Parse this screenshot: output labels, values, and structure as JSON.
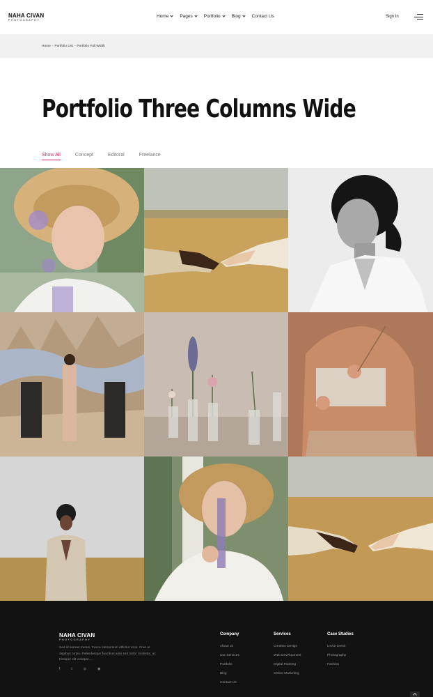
{
  "header": {
    "logo_name": "NAHA CIVAN",
    "logo_sub": "PHOTOGRAPHY",
    "nav": [
      {
        "label": "Home",
        "dropdown": true
      },
      {
        "label": "Pages",
        "dropdown": true
      },
      {
        "label": "Portfolio",
        "dropdown": true
      },
      {
        "label": "Blog",
        "dropdown": true
      },
      {
        "label": "Contact Us",
        "dropdown": false
      }
    ],
    "signin": "Sign In",
    "menu_icon": "hamburger-icon"
  },
  "breadcrumb": [
    "Home",
    "Portfolio List",
    "Portfolio Full Width"
  ],
  "page_title": "Portfolio Three Columns Wide",
  "filters": [
    {
      "label": "Show All",
      "active": true
    },
    {
      "label": "Concept",
      "active": false
    },
    {
      "label": "Editoral",
      "active": false
    },
    {
      "label": "Freelance",
      "active": false
    }
  ],
  "accent_color": "#d9255e",
  "grid": [
    "woman-straw-hat-flowers",
    "hands-reaching-wheat-field",
    "woman-profile-bw",
    "group-desert-fabric",
    "flowers-in-glass-vases",
    "woman-holding-dried-flowers",
    "man-covering-eyes-field",
    "woman-hat-lavender",
    "hands-reaching-field-wide"
  ],
  "footer": {
    "logo_name": "NAHA CIVAN",
    "logo_sub": "PHOTOGRAPHY",
    "description": "Sed id laoreet metus. Fusce elementum efficitur eros. Cras at dapibus turpis. Pellentesque faucibus ante sed tortor molestie, ac tristique elit volutpat.....",
    "social": [
      "f",
      "t",
      "◎",
      "◉"
    ],
    "columns": [
      {
        "title": "Company",
        "items": [
          "About us",
          "Our Services",
          "Portfolio",
          "Blog",
          "Contact Us"
        ]
      },
      {
        "title": "Services",
        "items": [
          "Creative Design",
          "Web Development",
          "Digital Painting",
          "Online Marketing"
        ]
      },
      {
        "title": "Case Studies",
        "items": [
          "UX/UI Desin",
          "Photography",
          "Fashion"
        ]
      }
    ]
  }
}
